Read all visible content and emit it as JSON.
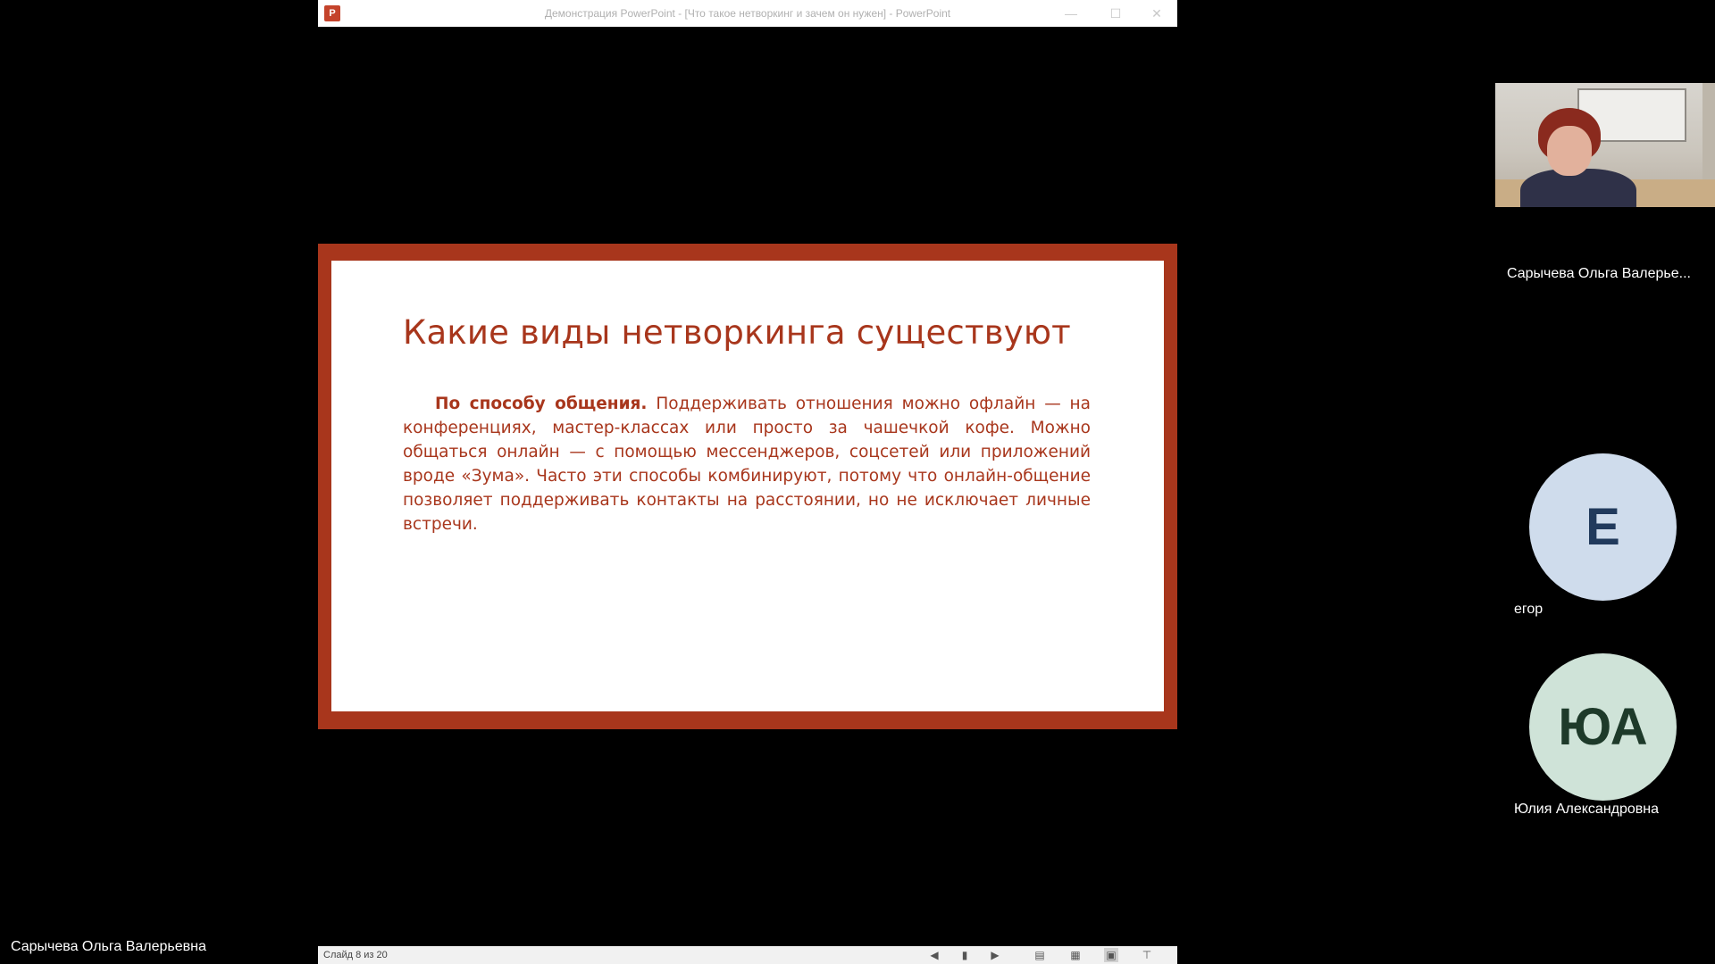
{
  "ppt_window": {
    "app_icon_letter": "P",
    "title": "Демонстрация PowerPoint - [Что такое нетворкинг и зачем он нужен] - PowerPoint",
    "controls": {
      "minimize": "—",
      "maximize": "☐",
      "close": "✕"
    }
  },
  "slide": {
    "heading": "Какие виды нетворкинга существуют",
    "body_bold": "По способу общения.",
    "body_text": " Поддерживать отношения можно офлайн — на конференциях, мастер-классах или просто за чашечкой кофе. Можно общаться онлайн — с помощью мессенджеров, соцсетей или приложений вроде «Зума». Часто эти способы комбинируют, потому что онлайн-общение позволяет поддерживать контакты на расстоянии, но не исключает личные встречи."
  },
  "statusbar": {
    "slide_counter": "Слайд 8 из 20",
    "buttons": [
      "prev-icon",
      "notes-icon",
      "next-icon",
      "normal-view-icon",
      "slide-sorter-icon",
      "reading-view-icon",
      "slideshow-icon"
    ],
    "glyphs": {
      "prev": "◀",
      "notes": "▮",
      "next": "▶",
      "normal": "▤",
      "sorter": "▦",
      "reading": "▣",
      "slideshow": "⊤"
    }
  },
  "presenter": {
    "name": "Сарычева Ольга Валерьевна"
  },
  "participants": [
    {
      "name": "Сарычева Ольга Валерье...",
      "type": "video"
    },
    {
      "name": "егор",
      "initials": "Е",
      "type": "avatar"
    },
    {
      "name": "Юлия Александровна",
      "initials": "ЮА",
      "type": "avatar"
    }
  ],
  "colors": {
    "slide_accent": "#a8361c",
    "background": "#000000"
  }
}
